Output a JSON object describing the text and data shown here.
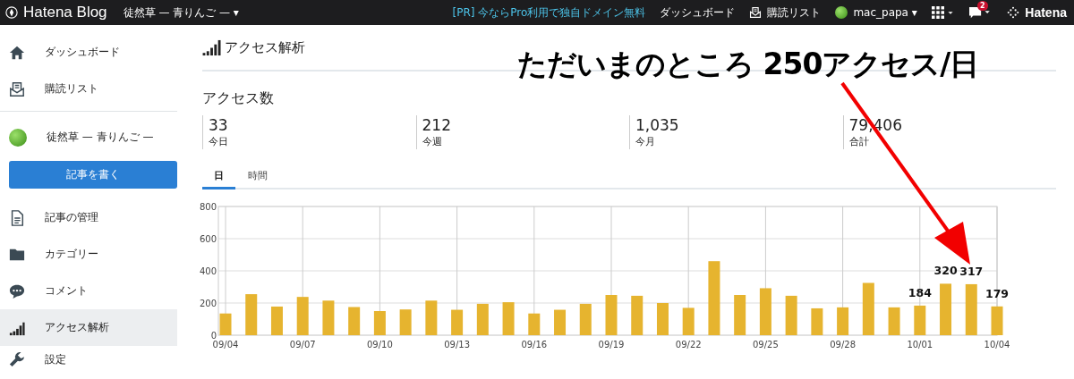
{
  "topbar": {
    "logo": "Hatena Blog",
    "blog_name": "徒然草 — 青りんご —",
    "caret": "▾",
    "links": [
      {
        "kind": "promo",
        "label": "[PR] 今ならPro利用で独自ドメイン無料"
      },
      {
        "kind": "plain",
        "label": "ダッシュボード"
      },
      {
        "kind": "reader",
        "label": "購読リスト"
      },
      {
        "kind": "user",
        "label": "mac_papa"
      }
    ],
    "notification_count": "2",
    "hatena_label": "Hatena"
  },
  "sidebar": {
    "items": [
      {
        "kind": "home",
        "label": "ダッシュボード",
        "selected": false
      },
      {
        "kind": "reader",
        "label": "購読リスト",
        "selected": false
      },
      {
        "kind": "divider"
      },
      {
        "kind": "blog",
        "label": "徒然草 — 青りんご —",
        "selected": false
      },
      {
        "kind": "write",
        "label": "記事を書く"
      },
      {
        "kind": "doc",
        "label": "記事の管理",
        "selected": false
      },
      {
        "kind": "folder",
        "label": "カテゴリー",
        "selected": false
      },
      {
        "kind": "comment",
        "label": "コメント",
        "selected": false
      },
      {
        "kind": "signal",
        "label": "アクセス解析",
        "selected": true
      },
      {
        "kind": "wrench",
        "label": "設定",
        "selected": false
      }
    ]
  },
  "page": {
    "title": "アクセス解析",
    "section": "アクセス数",
    "stats": [
      {
        "value": "33",
        "label": "今日"
      },
      {
        "value": "212",
        "label": "今週"
      },
      {
        "value": "1,035",
        "label": "今月"
      },
      {
        "value": "79,406",
        "label": "合計"
      }
    ],
    "tabs": [
      {
        "label": "日",
        "selected": true
      },
      {
        "label": "時間",
        "selected": false
      }
    ],
    "chart_data": {
      "type": "bar",
      "grid": true,
      "categories": [
        "09/04",
        null,
        null,
        "09/07",
        null,
        null,
        "09/10",
        null,
        null,
        "09/13",
        null,
        null,
        "09/16",
        null,
        null,
        "09/19",
        null,
        null,
        "09/22",
        null,
        null,
        "09/25",
        null,
        null,
        "09/28",
        null,
        null,
        "10/01",
        null,
        null,
        "10/04"
      ],
      "series": [
        {
          "color": "#e6b42f",
          "values": [
            135,
            255,
            178,
            238,
            215,
            175,
            150,
            160,
            215,
            158,
            195,
            205,
            135,
            158,
            195,
            250,
            245,
            200,
            170,
            460,
            250,
            292,
            245,
            167,
            173,
            325,
            173,
            184,
            320,
            317,
            179
          ]
        }
      ],
      "ylim": [
        0,
        800
      ],
      "yticks": [
        0,
        200,
        400,
        600,
        800
      ],
      "value_labels": [
        null,
        null,
        null,
        null,
        null,
        null,
        null,
        null,
        null,
        null,
        null,
        null,
        null,
        null,
        null,
        null,
        null,
        null,
        null,
        null,
        null,
        null,
        null,
        null,
        null,
        null,
        null,
        "184",
        "320",
        "317",
        "179"
      ]
    }
  },
  "overlay": {
    "text": "ただいまのところ 250アクセス/日"
  }
}
